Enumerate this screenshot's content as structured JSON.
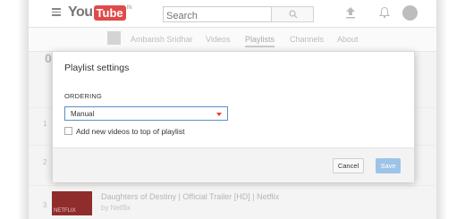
{
  "header": {
    "logo_you": "You",
    "logo_tube": "Tube",
    "logo_region": "IN",
    "search_placeholder": "Search"
  },
  "channel_nav": {
    "channel_name": "Ambarish Sridhar",
    "tabs": [
      "Videos",
      "Playlists",
      "Channels",
      "About"
    ],
    "active_tab": "Playlists"
  },
  "playlist": {
    "heading_initial": "0",
    "row_numbers": [
      "1",
      "2",
      "3"
    ],
    "visible_video": {
      "title": "Daughters of Destiny | Official Trailer [HD] | Netflix",
      "channel": "by Netflix",
      "thumb_text": "NETFLIX"
    }
  },
  "dialog": {
    "title": "Playlist settings",
    "ordering_label": "ORDERING",
    "ordering_value": "Manual",
    "add_to_top_label": "Add new videos to top of playlist",
    "add_to_top_checked": false,
    "cancel_label": "Cancel",
    "save_label": "Save"
  },
  "colors": {
    "save_button": "#9dc3e8",
    "select_border": "#5a8fc8",
    "caret": "#e0452f"
  }
}
